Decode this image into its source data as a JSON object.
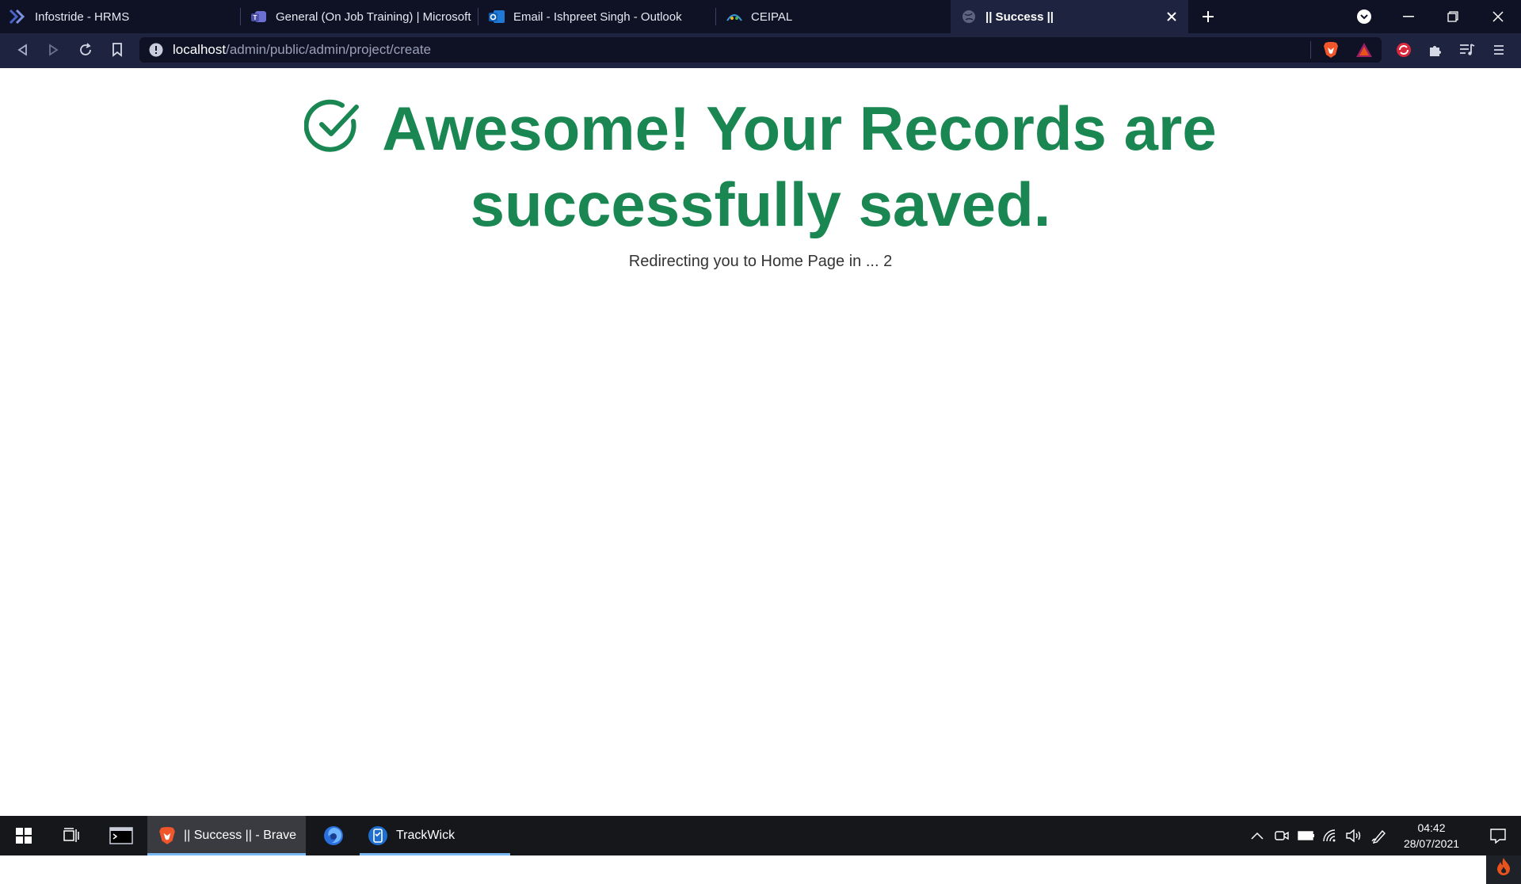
{
  "browser": {
    "tabs": [
      {
        "label": "Infostride - HRMS",
        "icon": "infostride-icon",
        "active": false
      },
      {
        "label": "General (On Job Training) | Microsoft T",
        "icon": "teams-icon",
        "active": false
      },
      {
        "label": "Email - Ishpreet Singh - Outlook",
        "icon": "outlook-icon",
        "active": false
      },
      {
        "label": "CEIPAL",
        "icon": "ceipal-icon",
        "active": false
      },
      {
        "label": "|| Success ||",
        "icon": "globe-icon",
        "active": true
      }
    ],
    "url_host": "localhost",
    "url_path": "/admin/public/admin/project/create"
  },
  "page": {
    "headline": "Awesome! Your Records are successfully saved.",
    "redirect_text": "Redirecting you to Home Page in ... 2",
    "accent_color": "#1a8753"
  },
  "taskbar": {
    "items": [
      {
        "label": "|| Success || - Brave",
        "icon": "brave-icon",
        "active": true
      },
      {
        "label": "",
        "icon": "firefox-icon",
        "active": false
      },
      {
        "label": "TrackWick",
        "icon": "trackwick-icon",
        "active": false
      }
    ],
    "time": "04:42",
    "date": "28/07/2021"
  }
}
